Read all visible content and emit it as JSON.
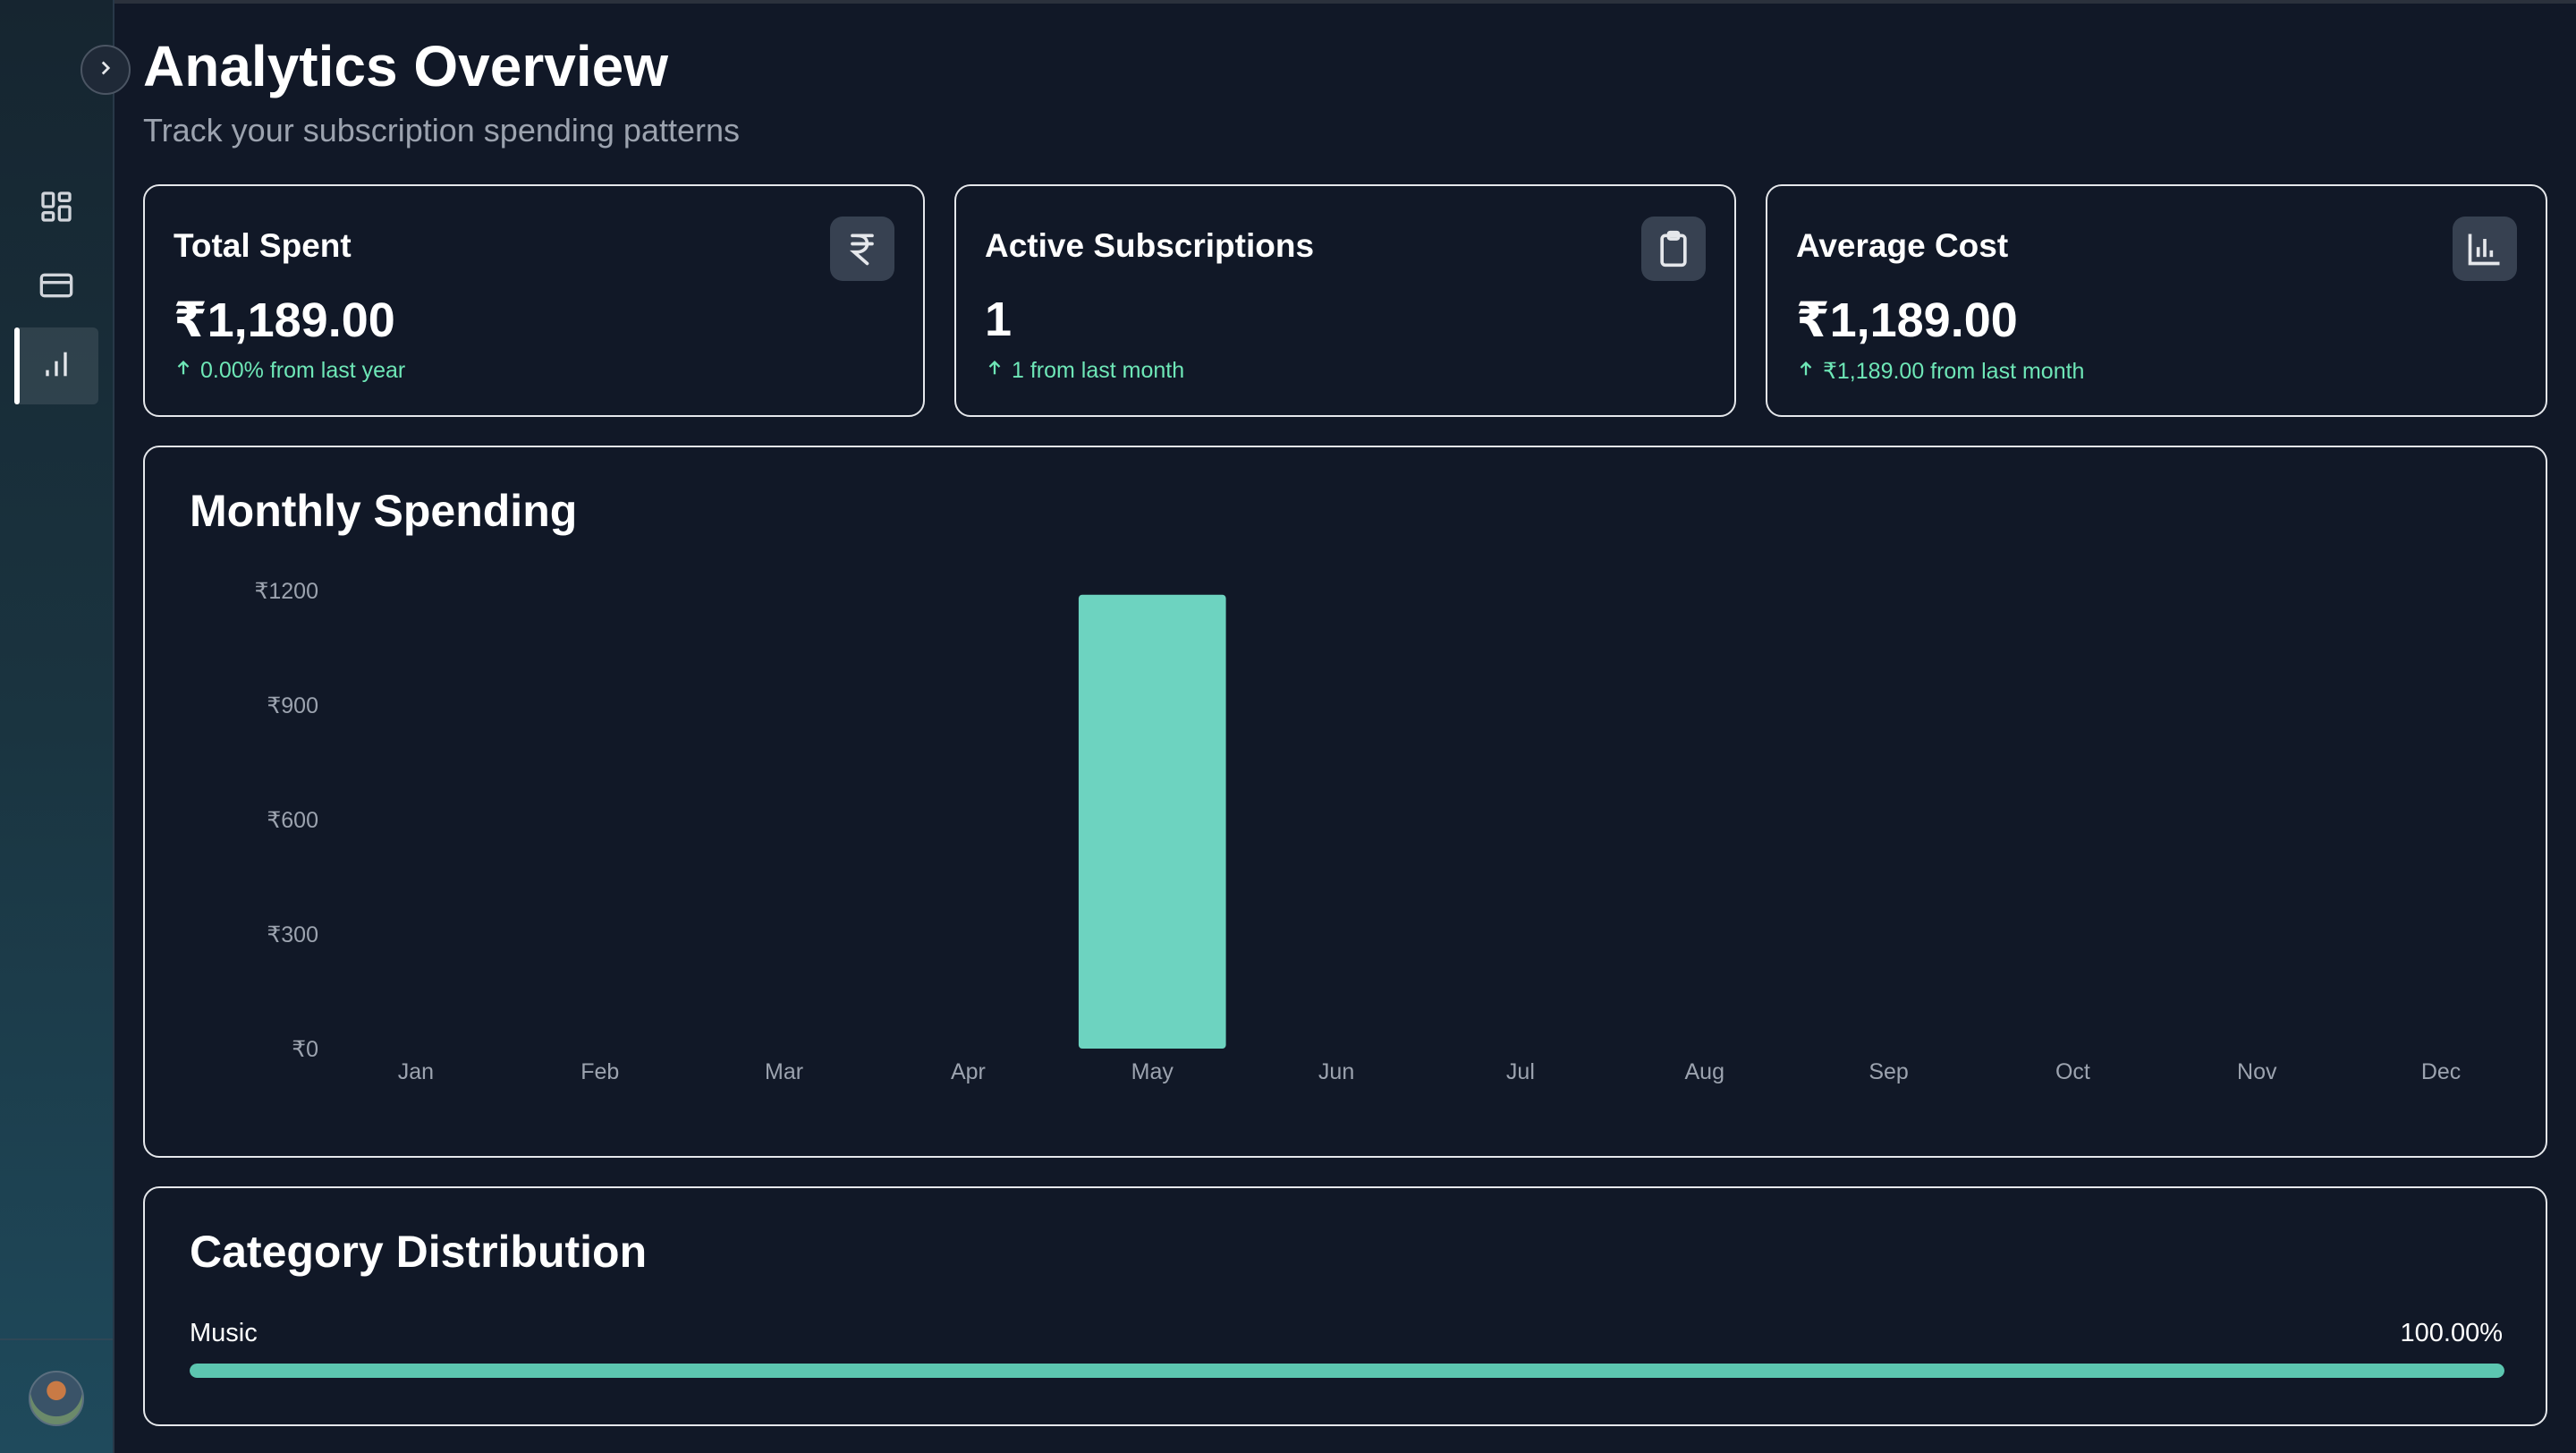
{
  "page": {
    "title": "Analytics Overview",
    "subtitle": "Track your subscription spending patterns"
  },
  "sidebar": {
    "toggle_icon": "chevron-right-icon",
    "items": [
      {
        "name": "dashboard",
        "icon": "grid-icon",
        "active": false
      },
      {
        "name": "subscriptions",
        "icon": "credit-card-icon",
        "active": false
      },
      {
        "name": "analytics",
        "icon": "bar-chart-icon",
        "active": true
      }
    ],
    "avatar": "user-avatar"
  },
  "stats": [
    {
      "title": "Total Spent",
      "value": "₹1,189.00",
      "change": "0.00% from last year",
      "icon": "rupee-icon"
    },
    {
      "title": "Active Subscriptions",
      "value": "1",
      "change": "1 from last month",
      "icon": "clipboard-icon"
    },
    {
      "title": "Average Cost",
      "value": "₹1,189.00",
      "change": "₹1,189.00 from last month",
      "icon": "bar-chart-icon"
    }
  ],
  "colors": {
    "background": "#111827",
    "accent": "#6dd3c0",
    "positive": "#6ee7b7",
    "muted_text": "#9ca3af"
  },
  "monthly": {
    "title": "Monthly Spending"
  },
  "chart_data": {
    "type": "bar",
    "title": "Monthly Spending",
    "categories": [
      "Jan",
      "Feb",
      "Mar",
      "Apr",
      "May",
      "Jun",
      "Jul",
      "Aug",
      "Sep",
      "Oct",
      "Nov",
      "Dec"
    ],
    "values": [
      0,
      0,
      0,
      0,
      1189,
      0,
      0,
      0,
      0,
      0,
      0,
      0
    ],
    "ylim": [
      0,
      1200
    ],
    "yticks": [
      0,
      300,
      600,
      900,
      1200
    ],
    "ytick_labels": [
      "₹0",
      "₹300",
      "₹600",
      "₹900",
      "₹1200"
    ],
    "grid": false,
    "color": "#6dd3c0"
  },
  "category": {
    "title": "Category Distribution",
    "items": [
      {
        "name": "Music",
        "percent_label": "100.00%",
        "fraction": 1.0
      }
    ]
  }
}
